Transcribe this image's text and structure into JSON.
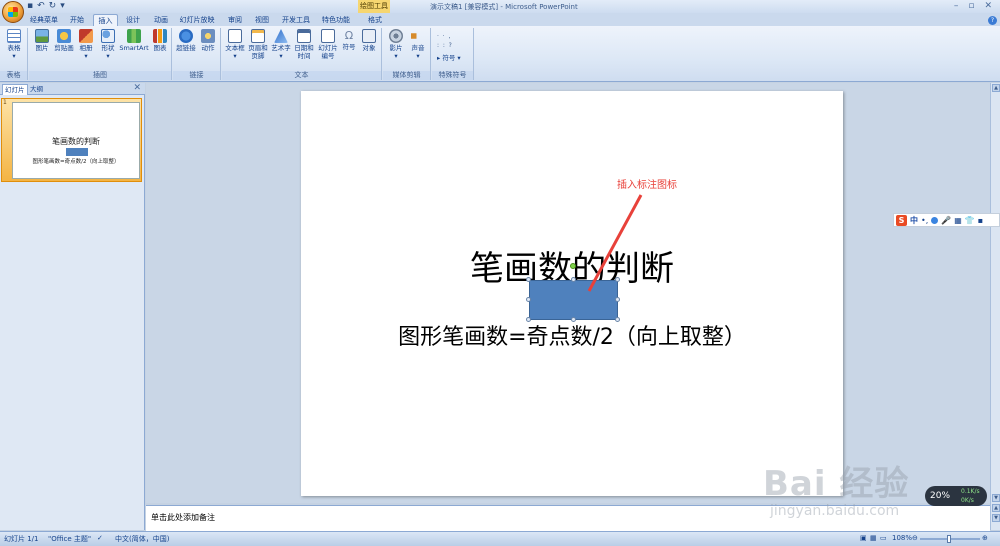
{
  "window": {
    "title": "演示文稿1 [兼容模式] - Microsoft PowerPoint",
    "contextual_tab": "绘图工具"
  },
  "tabs": [
    "经典菜单",
    "开始",
    "插入",
    "设计",
    "动画",
    "幻灯片放映",
    "审阅",
    "视图",
    "开发工具",
    "特色功能",
    "格式"
  ],
  "active_tab": "插入",
  "ribbon": {
    "groups": {
      "tables": "表格",
      "illustrations": "插图",
      "links": "链接",
      "text": "文本",
      "media": "媒体剪辑",
      "special": "特殊符号"
    },
    "buttons": {
      "table": "表格",
      "picture": "图片",
      "clipart": "剪贴画",
      "album": "相册",
      "shapes": "形状",
      "smartart": "SmartArt",
      "chart": "图表",
      "hyperlink": "超链接",
      "action": "动作",
      "textbox": "文本框",
      "header": "页眉和页脚",
      "wordart": "艺术字",
      "datetime": "日期和时间",
      "slidenum": "幻灯片编号",
      "symbol": "符号",
      "object": "对象",
      "movie": "影片",
      "sound": "声音",
      "special_symbol": "符号"
    }
  },
  "left_pane": {
    "tab_slides": "幻灯片",
    "tab_outline": "大纲",
    "thumb_number": "1",
    "thumb_title": "笔画数的判断",
    "thumb_sub": "图形笔画数=奇点数/2（向上取整）"
  },
  "slide": {
    "title": "笔画数的判断",
    "subtitle": "图形笔画数=奇点数/2（向上取整）",
    "annotation": "插入标注图标"
  },
  "notes": {
    "placeholder": "单击此处添加备注"
  },
  "status": {
    "slide_info": "幻灯片 1/1",
    "theme": "\"Office 主题\"",
    "language": "中文(简体，中国)",
    "zoom": "108%"
  },
  "ime": {
    "mode": "中"
  },
  "network": {
    "percent": "20%",
    "up": "0.1K/s",
    "down": "0K/s"
  },
  "watermark": {
    "brand": "Bai 经验",
    "url": "jingyan.baidu.com"
  },
  "colors": {
    "shape_fill": "#4f81bd",
    "annotation": "#e8413a",
    "ribbon": "#dde8f6"
  }
}
